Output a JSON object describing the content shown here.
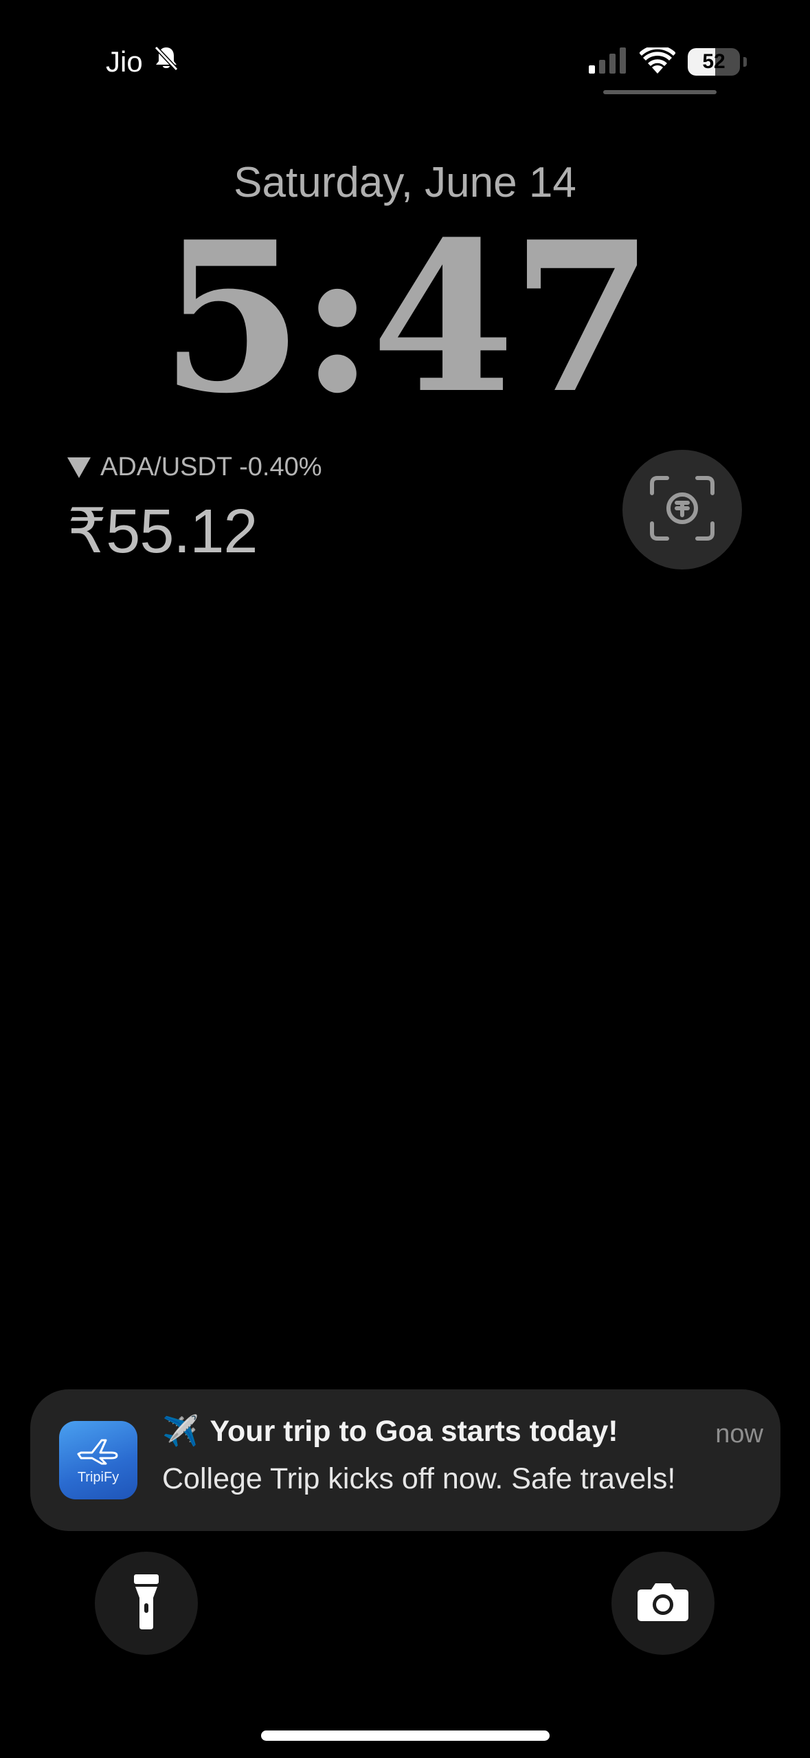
{
  "status_bar": {
    "carrier": "Jio",
    "battery_level": "52",
    "battery_fraction": 0.52,
    "icons": [
      "bell-slash-icon",
      "cellular-signal-icon",
      "wifi-icon",
      "battery-icon"
    ]
  },
  "lock_screen": {
    "date": "Saturday, June 14",
    "time": "5:47"
  },
  "crypto_widget": {
    "pair": "ADA/USDT",
    "change": "-0.40%",
    "trend_icon": "down-triangle-icon",
    "price": "₹55.12"
  },
  "scan_widget": {
    "icon": "scan-payment-icon"
  },
  "notification": {
    "app_name": "TripiFy",
    "emoji": "✈️",
    "title": "Your trip to Goa starts today!",
    "time": "now",
    "body": "College Trip kicks off now. Safe travels!"
  },
  "quick_actions": {
    "left_icon": "flashlight-icon",
    "right_icon": "camera-icon"
  },
  "colors": {
    "background": "#000000",
    "clock": "#a7a7a7",
    "notification_bg": "#232323",
    "app_icon_blue": "#2a6bd0"
  }
}
